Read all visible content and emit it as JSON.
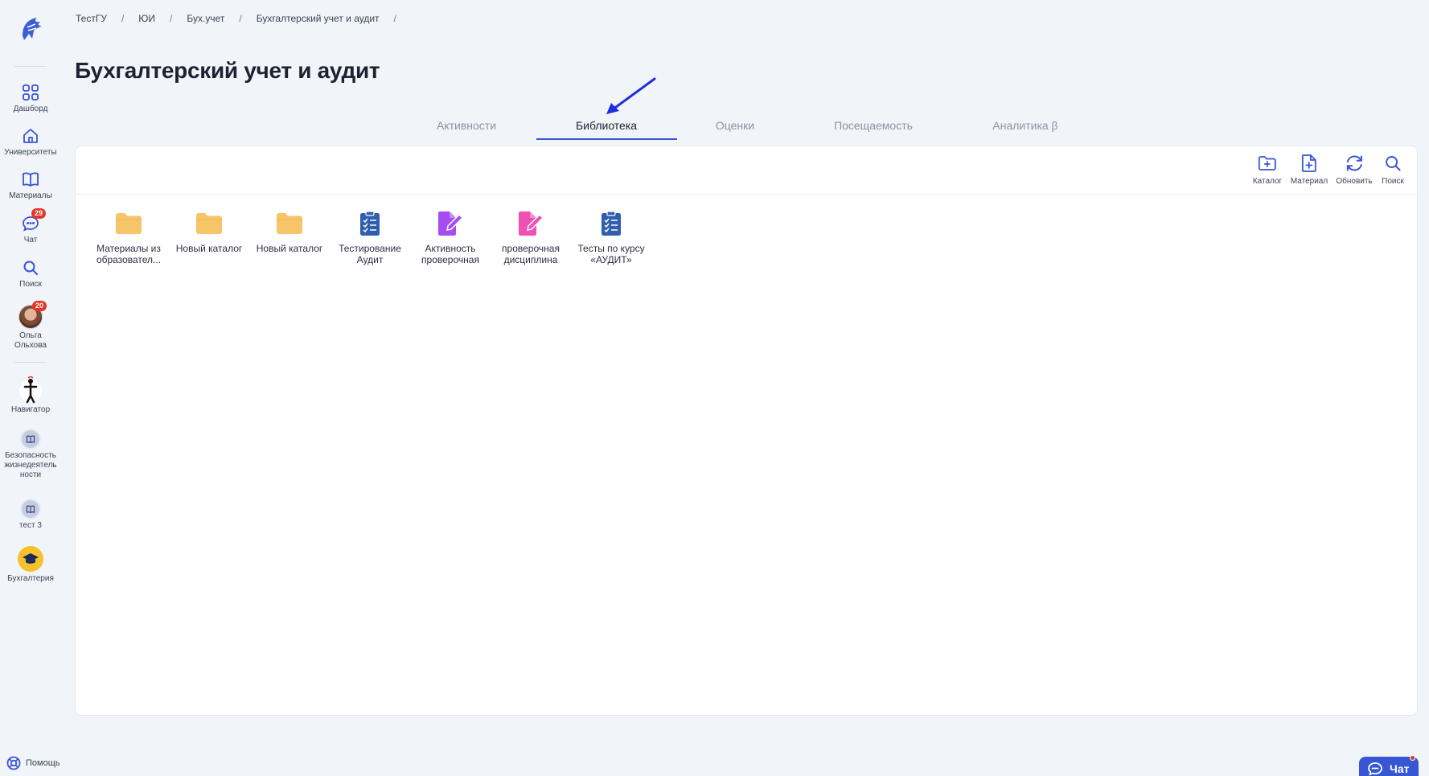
{
  "sidebar": {
    "logo_icon": "spartan-helmet-icon",
    "items": [
      {
        "label": "Дашборд",
        "icon": "grid-icon"
      },
      {
        "label": "Университеты",
        "icon": "home-icon"
      },
      {
        "label": "Материалы",
        "icon": "book-icon"
      },
      {
        "label": "Чат",
        "icon": "chat-icon",
        "badge": "29"
      },
      {
        "label": "Поиск",
        "icon": "search-icon"
      },
      {
        "label": "Ольга Ольхова",
        "icon": "avatar",
        "badge": "20"
      }
    ],
    "courses": [
      {
        "label": "Навигатор",
        "icon": "navigator-icon"
      },
      {
        "label": "Безопасность жизнедеятель ности",
        "icon": "course-book-icon"
      },
      {
        "label": "тест 3",
        "icon": "course-book-icon"
      },
      {
        "label": "Бухгалтерия",
        "icon": "graduation-cap-icon"
      }
    ],
    "help_label": "Помощь"
  },
  "breadcrumb": [
    "ТестГУ",
    "ЮИ",
    "Бух.учет",
    "Бухгалтерский учет и аудит"
  ],
  "page_title": "Бухгалтерский учет и аудит",
  "tabs": [
    {
      "label": "Активности",
      "active": false
    },
    {
      "label": "Библиотека",
      "active": true
    },
    {
      "label": "Оценки",
      "active": false
    },
    {
      "label": "Посещаемость",
      "active": false
    },
    {
      "label": "Аналитика β",
      "active": false
    }
  ],
  "toolbar": {
    "catalog": "Каталог",
    "material": "Материал",
    "refresh": "Обновить",
    "search": "Поиск"
  },
  "library_items": [
    {
      "name": "Материалы из образовател...",
      "type": "folder"
    },
    {
      "name": "Новый каталог",
      "type": "folder"
    },
    {
      "name": "Новый каталог",
      "type": "folder"
    },
    {
      "name": "Тестирование Аудит",
      "type": "test"
    },
    {
      "name": "Активность проверочная",
      "type": "assignment-purple"
    },
    {
      "name": "проверочная дисциплина",
      "type": "assignment-pink"
    },
    {
      "name": "Тесты по курсу «АУДИТ»",
      "type": "test"
    }
  ],
  "chat_button": "Чат",
  "colors": {
    "accent": "#3b54d6",
    "folder": "#f6c56a",
    "test": "#2f5fae",
    "assignment_purple": "#a64cf0",
    "assignment_pink": "#f04fb6",
    "badge": "#e5352a"
  }
}
